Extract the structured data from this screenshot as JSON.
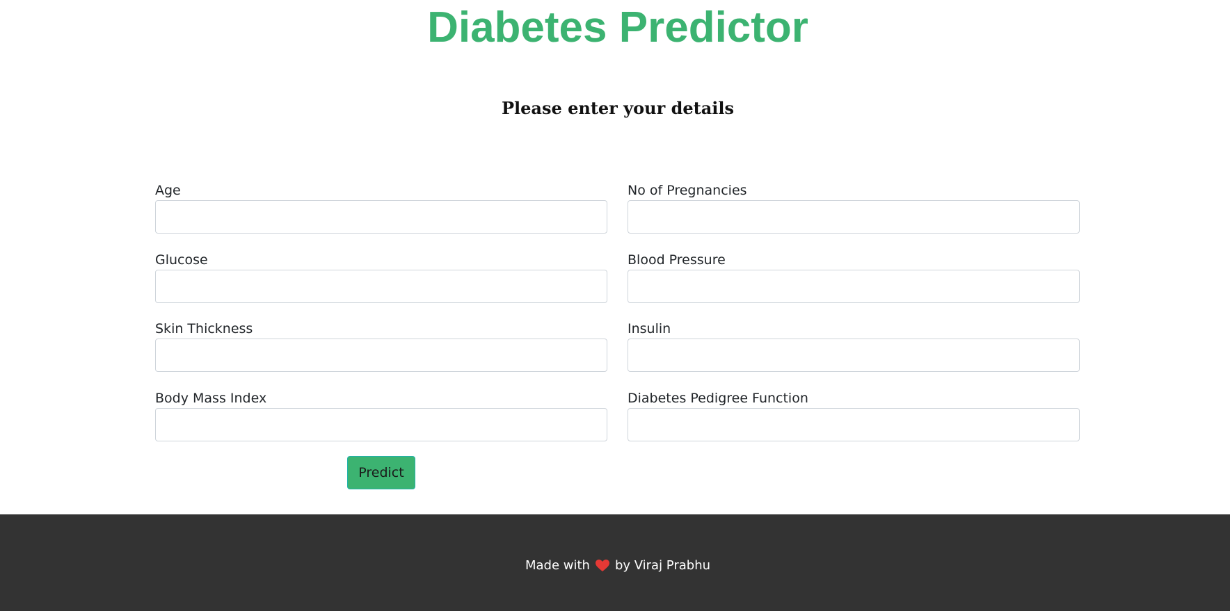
{
  "header": {
    "title": "Diabetes Predictor",
    "subtitle": "Please enter your details"
  },
  "form": {
    "fields": [
      {
        "label": "Age",
        "value": "",
        "placeholder": ""
      },
      {
        "label": "No of Pregnancies",
        "value": "",
        "placeholder": ""
      },
      {
        "label": "Glucose",
        "value": "",
        "placeholder": ""
      },
      {
        "label": "Blood Pressure",
        "value": "",
        "placeholder": ""
      },
      {
        "label": "Skin Thickness",
        "value": "",
        "placeholder": ""
      },
      {
        "label": "Insulin",
        "value": "",
        "placeholder": ""
      },
      {
        "label": "Body Mass Index",
        "value": "",
        "placeholder": ""
      },
      {
        "label": "Diabetes Pedigree Function",
        "value": "",
        "placeholder": ""
      }
    ],
    "submit_label": "Predict"
  },
  "footer": {
    "prefix": "Made with",
    "icon": "heart-icon",
    "suffix": "by Viraj Prabhu"
  },
  "colors": {
    "accent": "#3cb371",
    "footer_bg": "#333333",
    "heart": "#e53935"
  }
}
